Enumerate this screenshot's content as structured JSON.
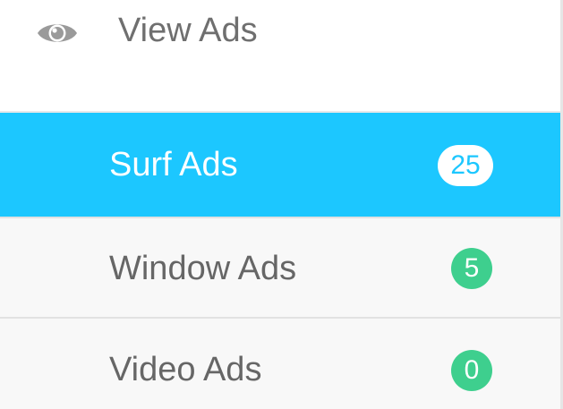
{
  "menu": {
    "header": {
      "icon": "eye-icon",
      "label": "View Ads"
    },
    "items": [
      {
        "label": "Surf Ads",
        "count": "25",
        "active": true
      },
      {
        "label": "Window Ads",
        "count": "5",
        "active": false
      },
      {
        "label": "Video Ads",
        "count": "0",
        "active": false
      }
    ]
  },
  "colors": {
    "active_background": "#1cc7ff",
    "badge_green": "#3ecf8e",
    "text_gray": "#666666",
    "item_background": "#f8f8f8"
  }
}
